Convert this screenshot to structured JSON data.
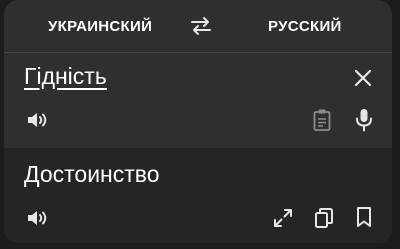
{
  "languages": {
    "source": "УКРАИНСКИЙ",
    "target": "РУССКИЙ"
  },
  "source": {
    "text": "Гідність"
  },
  "translation": {
    "text": "Достоинство"
  },
  "icons": {
    "swap": "swap-icon",
    "close": "close-icon",
    "speaker": "speaker-icon",
    "clipboard": "clipboard-icon",
    "mic": "microphone-icon",
    "expand": "expand-icon",
    "copy": "copy-icon",
    "bookmark": "bookmark-icon"
  },
  "colors": {
    "card_background": "#2f2f31",
    "translation_background": "#252527",
    "text": "#ffffff",
    "icon": "#e6e6e6",
    "icon_muted": "#8d8d90"
  }
}
